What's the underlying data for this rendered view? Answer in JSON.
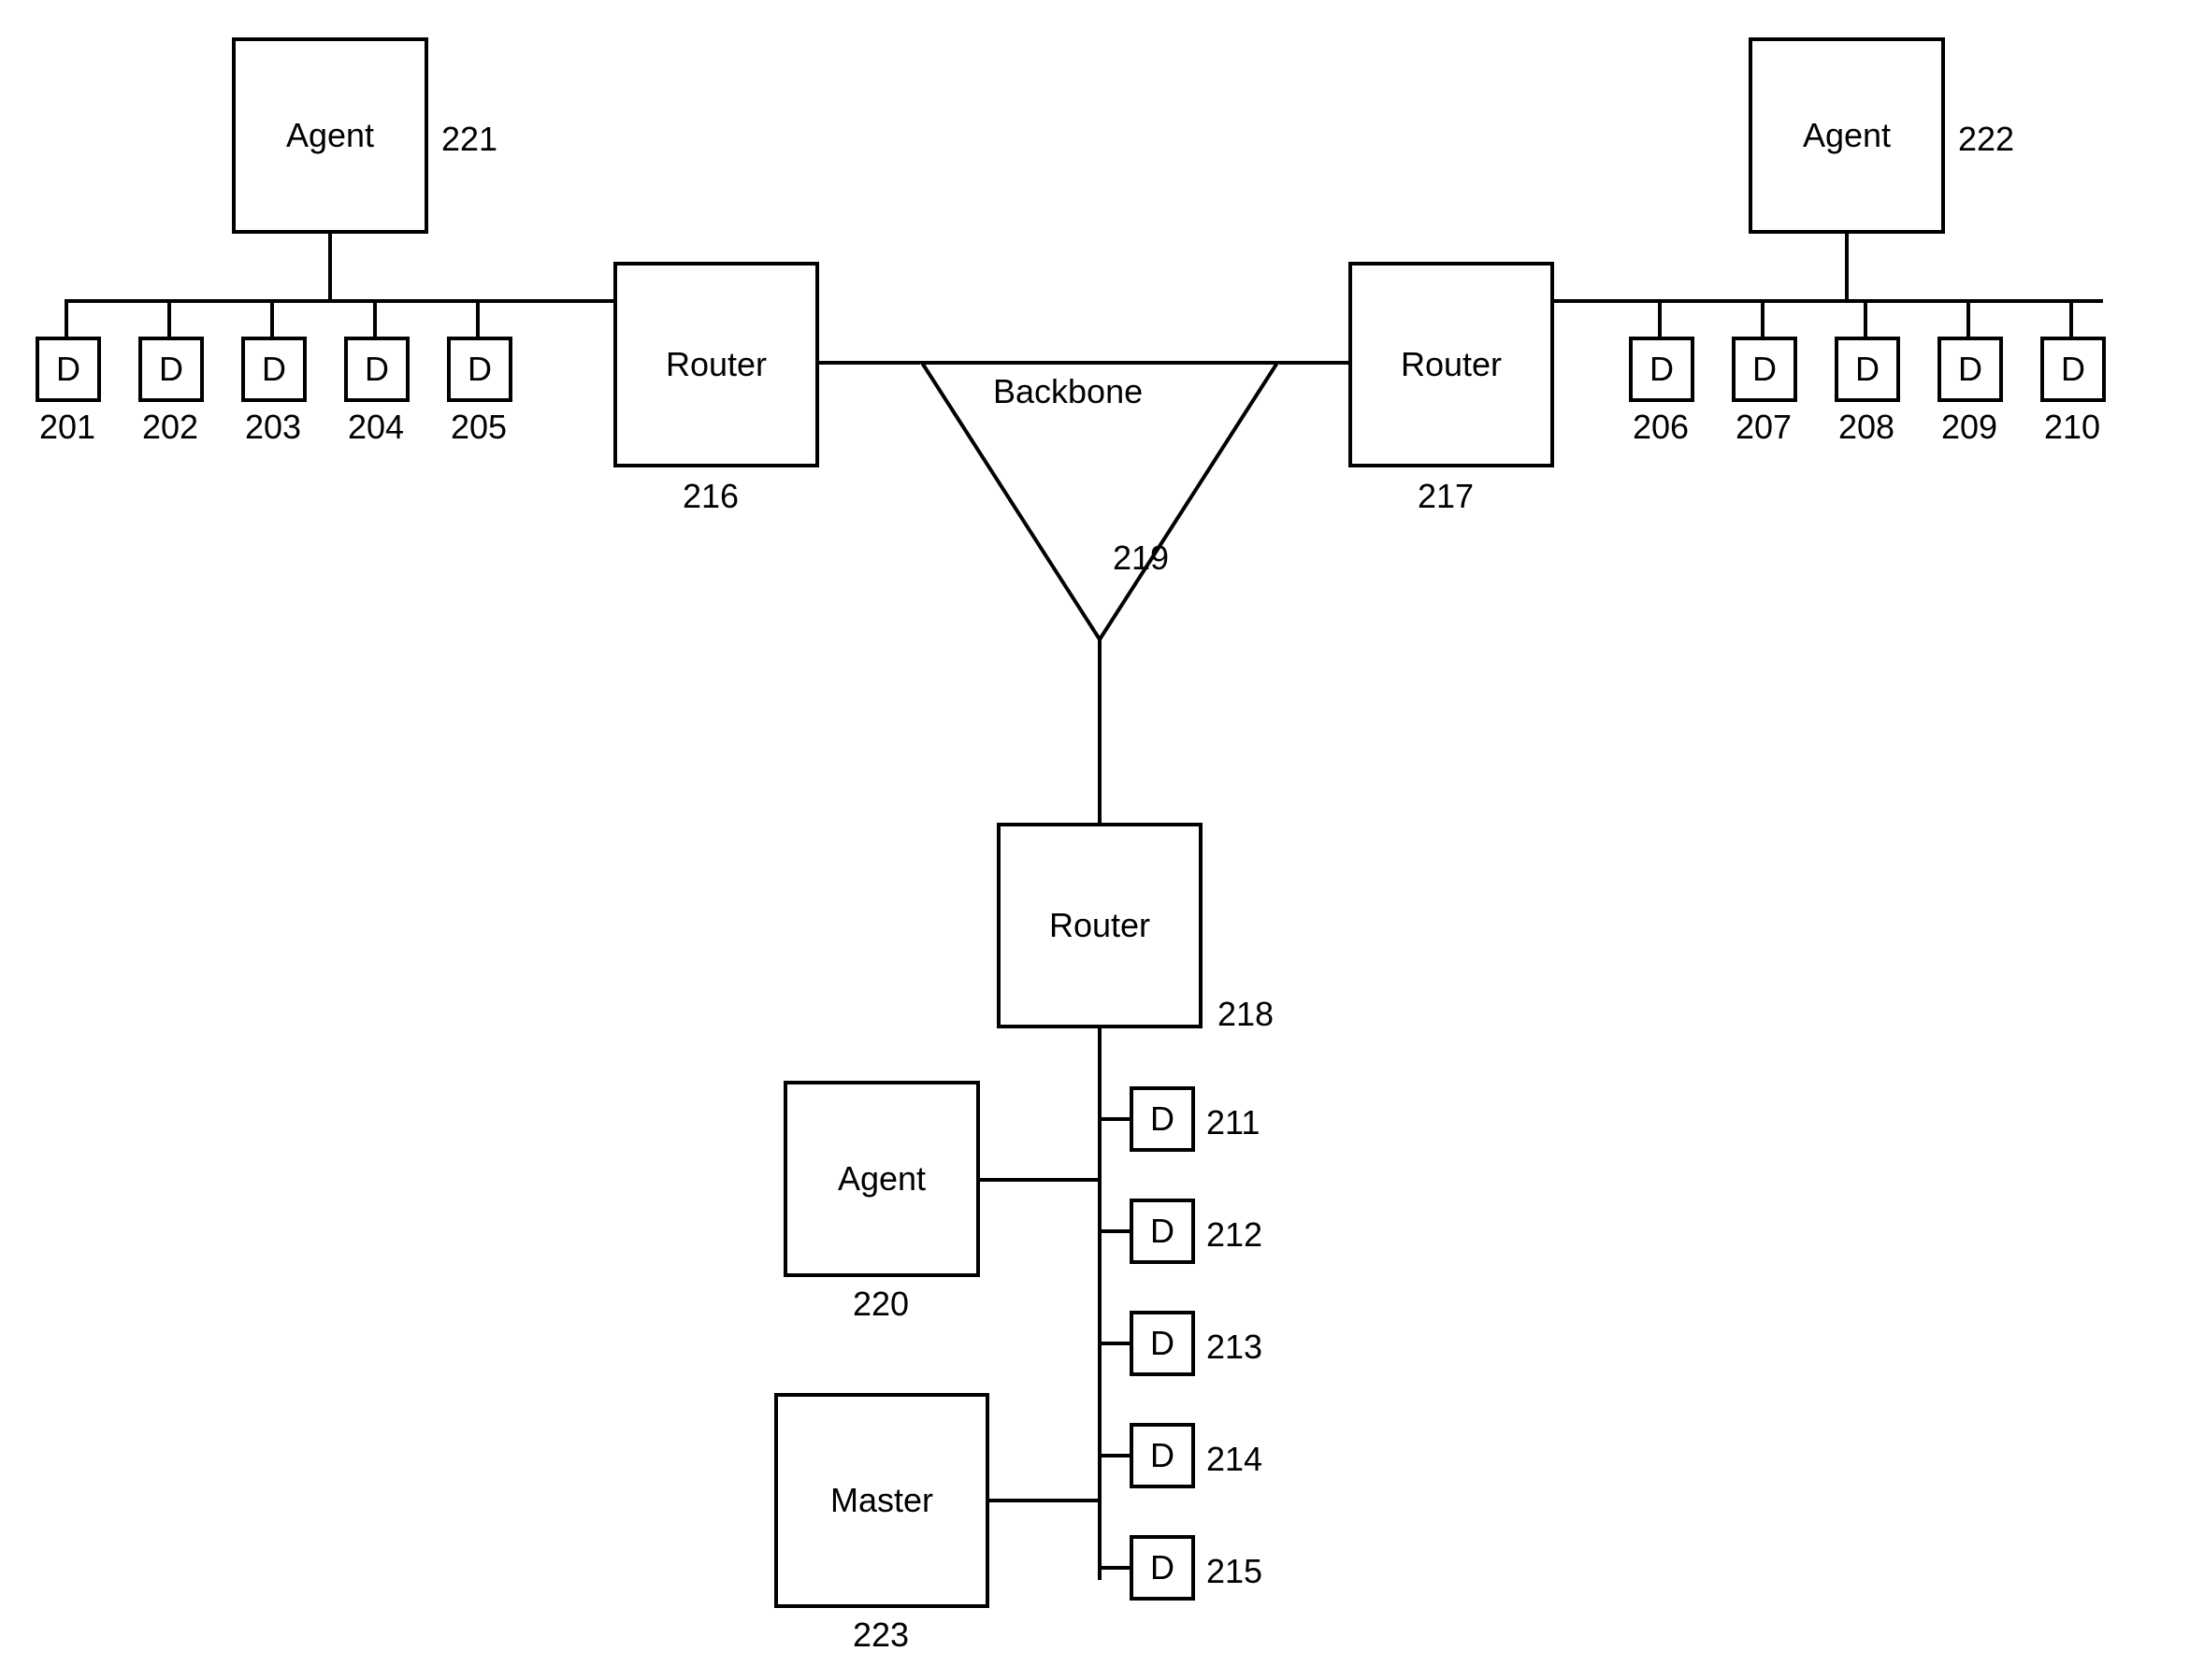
{
  "agents": {
    "a1": {
      "label": "Agent",
      "num": "221"
    },
    "a2": {
      "label": "Agent",
      "num": "222"
    },
    "a3": {
      "label": "Agent",
      "num": "220"
    }
  },
  "master": {
    "label": "Master",
    "num": "223"
  },
  "routers": {
    "r1": {
      "label": "Router",
      "num": "216"
    },
    "r2": {
      "label": "Router",
      "num": "217"
    },
    "r3": {
      "label": "Router",
      "num": "218"
    }
  },
  "backbone": {
    "label": "Backbone",
    "num": "219"
  },
  "d_left": {
    "d1": {
      "label": "D",
      "num": "201"
    },
    "d2": {
      "label": "D",
      "num": "202"
    },
    "d3": {
      "label": "D",
      "num": "203"
    },
    "d4": {
      "label": "D",
      "num": "204"
    },
    "d5": {
      "label": "D",
      "num": "205"
    }
  },
  "d_right": {
    "d6": {
      "label": "D",
      "num": "206"
    },
    "d7": {
      "label": "D",
      "num": "207"
    },
    "d8": {
      "label": "D",
      "num": "208"
    },
    "d9": {
      "label": "D",
      "num": "209"
    },
    "d10": {
      "label": "D",
      "num": "210"
    }
  },
  "d_bottom": {
    "d11": {
      "label": "D",
      "num": "211"
    },
    "d12": {
      "label": "D",
      "num": "212"
    },
    "d13": {
      "label": "D",
      "num": "213"
    },
    "d14": {
      "label": "D",
      "num": "214"
    },
    "d15": {
      "label": "D",
      "num": "215"
    }
  }
}
